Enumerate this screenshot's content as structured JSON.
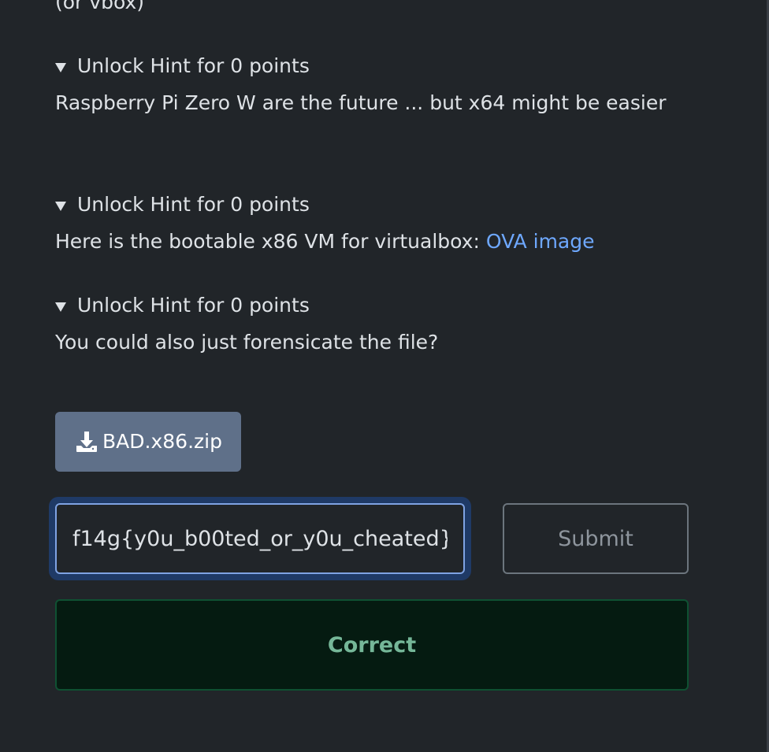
{
  "top_text": "(or vbox)",
  "hints": [
    {
      "summary": "Unlock Hint for 0 points",
      "body": "Raspberry Pi Zero W are the future ... but x64 might be easier"
    },
    {
      "summary": "Unlock Hint for 0 points",
      "body_prefix": "Here is the bootable x86 VM for virtualbox: ",
      "link_text": "OVA image"
    },
    {
      "summary": "Unlock Hint for 0 points",
      "body": "You could also just forensicate the file?"
    }
  ],
  "download": {
    "label": "BAD.x86.zip",
    "icon": "download-icon"
  },
  "flag_input": {
    "value": "f14g{y0u_b00ted_or_y0u_cheated}"
  },
  "submit": {
    "label": "Submit"
  },
  "result": {
    "message": "Correct"
  },
  "colors": {
    "background": "#212529",
    "link": "#6ea8fe",
    "download_button": "#5f7089",
    "input_focus_ring": "#1f3a66",
    "success_bg": "#051b11",
    "success_border": "#0f5132",
    "success_text": "#75b798"
  }
}
